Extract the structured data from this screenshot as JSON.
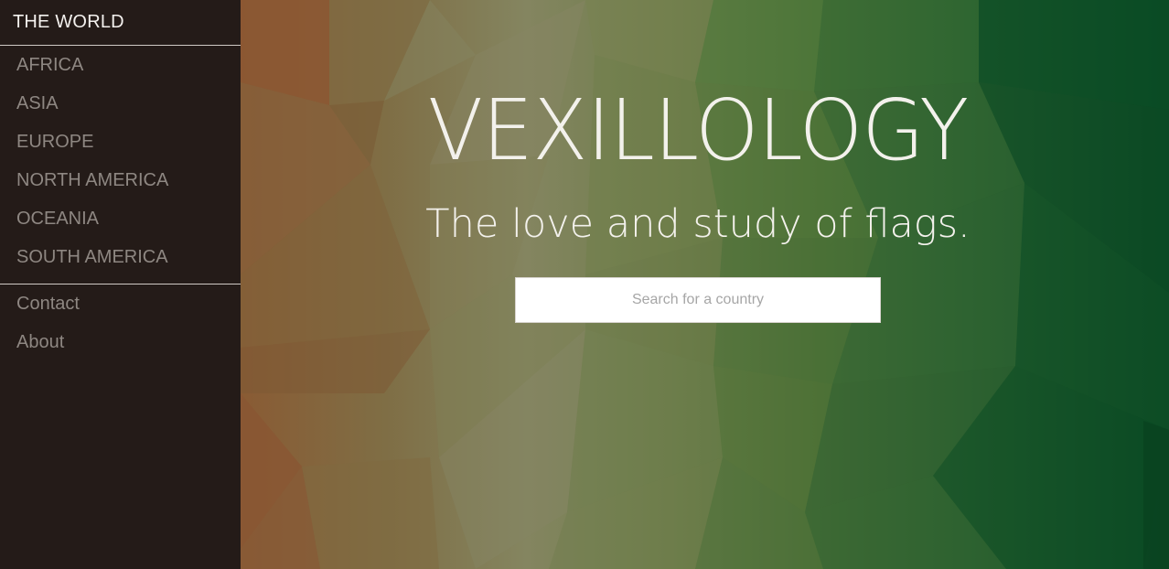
{
  "sidebar": {
    "brand": "THE WORLD",
    "regions": [
      {
        "label": "AFRICA"
      },
      {
        "label": "ASIA"
      },
      {
        "label": "EUROPE"
      },
      {
        "label": "NORTH AMERICA"
      },
      {
        "label": "OCEANIA"
      },
      {
        "label": "SOUTH AMERICA"
      }
    ],
    "secondary": [
      {
        "label": "Contact"
      },
      {
        "label": "About"
      }
    ]
  },
  "hero": {
    "title": "VEXILLOLOGY",
    "subtitle": "The love and study of flags."
  },
  "search": {
    "placeholder": "Search for a country",
    "value": ""
  },
  "colors": {
    "sidebar_bg": "#201917",
    "orange": "#8a5a35",
    "sage": "#7f8461",
    "green": "#0e5a2e",
    "text_light": "#f3f1ec",
    "nav_text": "#8e8782"
  }
}
